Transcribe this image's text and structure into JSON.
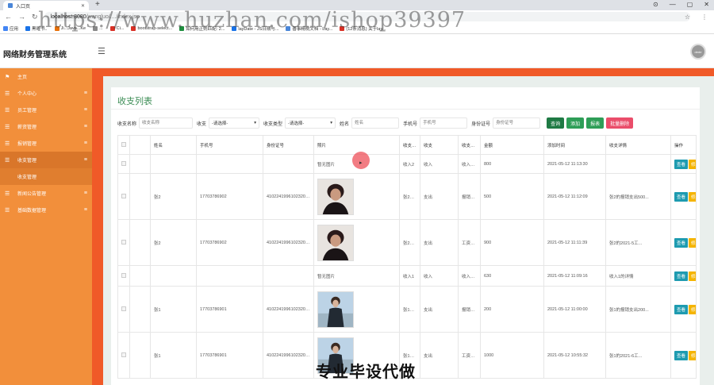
{
  "browser": {
    "tab_title": "入口页",
    "url_host": "localhost:8080",
    "url_path": "/wangluo/..../index.jsp",
    "bookmarks": [
      "应用",
      "黑曜书..",
      "Ji...Java...Ke",
      "...",
      "Ci...",
      "bootstrap-select...",
      "如何用正则匹配: 2...",
      "layDate - JS日期与...",
      "善事精桃文档 - Lay...",
      "(12条消息) 关于lay..."
    ]
  },
  "watermark": "https://www.huzhan.com/ishop39397",
  "app": {
    "title": "网络财务管理系统",
    "avatar_text": "dede"
  },
  "sidebar": {
    "items": [
      {
        "label": "主页",
        "icon": "flag-icon"
      },
      {
        "label": "个人中心",
        "icon": "list-icon"
      },
      {
        "label": "员工管理",
        "icon": "list-icon"
      },
      {
        "label": "薪资管理",
        "icon": "list-icon"
      },
      {
        "label": "报销管理",
        "icon": "list-icon"
      },
      {
        "label": "收支管理",
        "icon": "list-icon"
      },
      {
        "label": "收支管理",
        "icon": ""
      },
      {
        "label": "新闻公告管理",
        "icon": "list-icon"
      },
      {
        "label": "基础数据管理",
        "icon": "list-icon"
      }
    ]
  },
  "page": {
    "title": "收支列表"
  },
  "search": {
    "name_label": "收支名称",
    "name_placeholder": "收支名称",
    "type_label": "收支",
    "type_value": "-请选择-",
    "cat_label": "收支类型",
    "cat_value": "-请选择-",
    "person_label": "姓名",
    "person_placeholder": "姓名",
    "phone_label": "手机号",
    "phone_placeholder": "手机号",
    "id_label": "身份证号",
    "id_placeholder": "身份证号",
    "query_btn": "查询",
    "add_btn": "添加",
    "report_btn": "报表",
    "batch_delete_btn": "批量删除"
  },
  "table": {
    "headers": [
      "姓名",
      "手机号",
      "身份证号",
      "照片",
      "收支名称",
      "收支",
      "收支类型",
      "金额",
      "添加时间",
      "收支详情",
      "操作"
    ],
    "ops": {
      "view": "查看",
      "edit": "修改",
      "del": "删除"
    },
    "no_photo": "暂无图片",
    "rows": [
      {
        "name": "",
        "phone": "",
        "idcard": "",
        "photo": "none",
        "title": "收入2",
        "kind": "收入",
        "ktype": "收入类型2",
        "amount": "800",
        "time": "2021-05-12 11:13:30",
        "detail": ""
      },
      {
        "name": "张2",
        "phone": "17703786902",
        "idcard": "410224199610232002",
        "photo": "man-dark",
        "title": "张2的报销支出500.0",
        "kind": "支出",
        "ktype": "报销支出",
        "amount": "500",
        "time": "2021-05-12 11:12:09",
        "detail": "张2的报销支出500..."
      },
      {
        "name": "张2",
        "phone": "17703786902",
        "idcard": "410224199610232002",
        "photo": "man-dark",
        "title": "张2的2021-5工资支出900.0",
        "kind": "支出",
        "ktype": "工资支出",
        "amount": "900",
        "time": "2021-05-12 11:11:39",
        "detail": "张2的2021-5工..."
      },
      {
        "name": "",
        "phone": "",
        "idcard": "",
        "photo": "none",
        "title": "收入1",
        "kind": "收入",
        "ktype": "收入类型2",
        "amount": "630",
        "time": "2021-05-12 11:09:16",
        "detail": "收入1的详情"
      },
      {
        "name": "张1",
        "phone": "17703786901",
        "idcard": "410224199610232001",
        "photo": "man-light",
        "title": "张1的报销支出200.0",
        "kind": "支出",
        "ktype": "报销支出",
        "amount": "200",
        "time": "2021-05-12 11:00:00",
        "detail": "张1的报销支出200..."
      },
      {
        "name": "张1",
        "phone": "17703786901",
        "idcard": "410224199610232001",
        "photo": "man-light",
        "title": "张1的2021-6工资支出1000.0",
        "kind": "支出",
        "ktype": "工资支出",
        "amount": "1000",
        "time": "2021-05-12 10:55:32",
        "detail": "张1的2021-6工..."
      }
    ]
  },
  "overlay_text": "专业毕设代做",
  "colors": {
    "sidebar": "#f28f3b",
    "accent_green": "#2e9e57",
    "danger": "#ec3f5a",
    "warning": "#f5b400",
    "info": "#1e9bb0"
  }
}
